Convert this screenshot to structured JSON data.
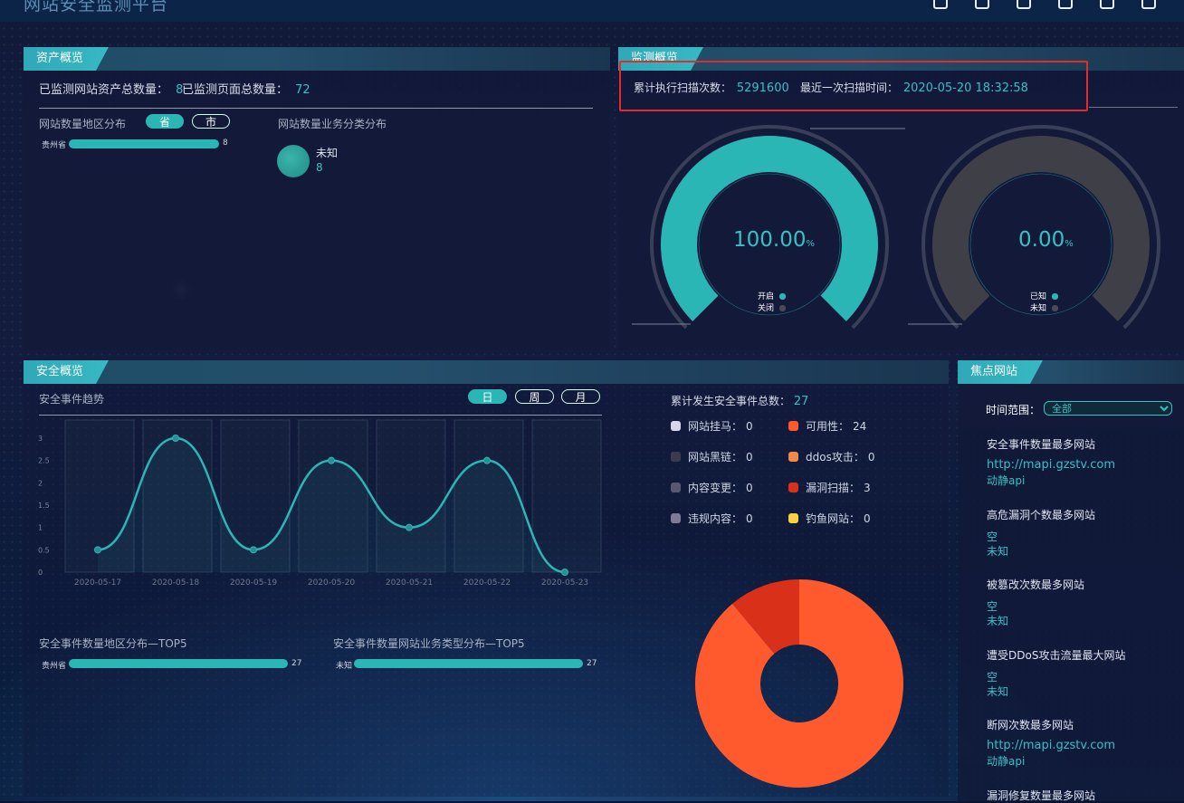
{
  "app": {
    "title": "网站安全监测平台"
  },
  "top_icons": [
    "home-icon",
    "globe-icon",
    "monitor-icon",
    "screen-icon",
    "back-icon",
    "settings-icon"
  ],
  "assets": {
    "tab": "资产概览",
    "site_total_label": "已监测网站资产总数量：",
    "site_total": "8",
    "page_total_label": "已监测页面总数量：",
    "page_total": "72",
    "region_title": "网站数量地区分布",
    "btn_province": "省",
    "btn_city": "市",
    "region_bars": [
      {
        "name": "贵州省",
        "value": "8",
        "fraction": 1.0
      }
    ],
    "biz_title": "网站数量业务分类分布",
    "biz_items": [
      {
        "name": "未知",
        "value": "8"
      }
    ]
  },
  "monitor": {
    "tab": "监测概览",
    "scan_count_label": "累计执行扫描次数：",
    "scan_count": "5291600",
    "last_scan_label": "最近一次扫描时间：",
    "last_scan": "2020-05-20 18:32:58",
    "gauges": [
      {
        "value": "100.00",
        "unit": "%",
        "fraction": 1.0,
        "legend": [
          "开启",
          "关闭"
        ],
        "color": "#2bb6b6"
      },
      {
        "value": "0.00",
        "unit": "%",
        "fraction": 0.0,
        "legend": [
          "已知",
          "未知"
        ],
        "color": "#4a4a52"
      }
    ]
  },
  "security": {
    "tab": "安全概览",
    "trend_title": "安全事件趋势",
    "btn_day": "日",
    "btn_week": "周",
    "btn_month": "月",
    "total_label": "累计发生安全事件总数：",
    "total": "27",
    "stats": [
      {
        "label": "网站挂马：",
        "value": "0",
        "color": "#d9d4e8"
      },
      {
        "label": "可用性：",
        "value": "24",
        "color": "#ff5a2e"
      },
      {
        "label": "网站黑链：",
        "value": "0",
        "color": "#3e3a4e"
      },
      {
        "label": "ddos攻击：",
        "value": "0",
        "color": "#f08a4b"
      },
      {
        "label": "内容变更：",
        "value": "0",
        "color": "#5a5870"
      },
      {
        "label": "漏洞扫描：",
        "value": "3",
        "color": "#d9301a"
      },
      {
        "label": "违规内容：",
        "value": "0",
        "color": "#7e7a96"
      },
      {
        "label": "钓鱼网站：",
        "value": "0",
        "color": "#f7d23a"
      }
    ],
    "region_top_title": "安全事件数量地区分布—TOP5",
    "region_top": [
      {
        "name": "贵州省",
        "value": "27"
      }
    ],
    "biz_top_title": "安全事件数量网站业务类型分布—TOP5",
    "biz_top": [
      {
        "name": "未知",
        "value": "27"
      }
    ]
  },
  "chart_data": [
    {
      "type": "line",
      "title": "安全事件趋势",
      "x": [
        "2020-05-17",
        "2020-05-18",
        "2020-05-19",
        "2020-05-20",
        "2020-05-21",
        "2020-05-22",
        "2020-05-23"
      ],
      "y_ticks": [
        "3",
        "2.5",
        "2",
        "1.5",
        "1",
        "0.5",
        "0"
      ],
      "values": [
        0.5,
        3,
        0.5,
        2.5,
        1,
        2.5,
        0
      ],
      "ylim": [
        0,
        3
      ],
      "smooth": true,
      "color": "#2bb6b6"
    },
    {
      "type": "pie",
      "slices": [
        {
          "name": "可用性",
          "value": 24,
          "color": "#ff5a2e"
        },
        {
          "name": "漏洞扫描",
          "value": 3,
          "color": "#d9301a"
        }
      ],
      "donut": true
    }
  ],
  "focus": {
    "tab": "焦点网站",
    "range_label": "时间范围：",
    "range_value": "全部",
    "sections": [
      {
        "title": "安全事件数量最多网站",
        "lines": [
          "http://mapi.gzstv.com",
          "动静api"
        ]
      },
      {
        "title": "高危漏洞个数最多网站",
        "lines": [
          "空",
          "未知"
        ]
      },
      {
        "title": "被篡改次数最多网站",
        "lines": [
          "空",
          "未知"
        ]
      },
      {
        "title": "遭受DDoS攻击流量最大网站",
        "lines": [
          "空",
          "未知"
        ]
      },
      {
        "title": "断网次数最多网站",
        "lines": [
          "http://mapi.gzstv.com",
          "动静api"
        ]
      },
      {
        "title": "漏洞修复数量最多网站",
        "lines": []
      }
    ]
  }
}
